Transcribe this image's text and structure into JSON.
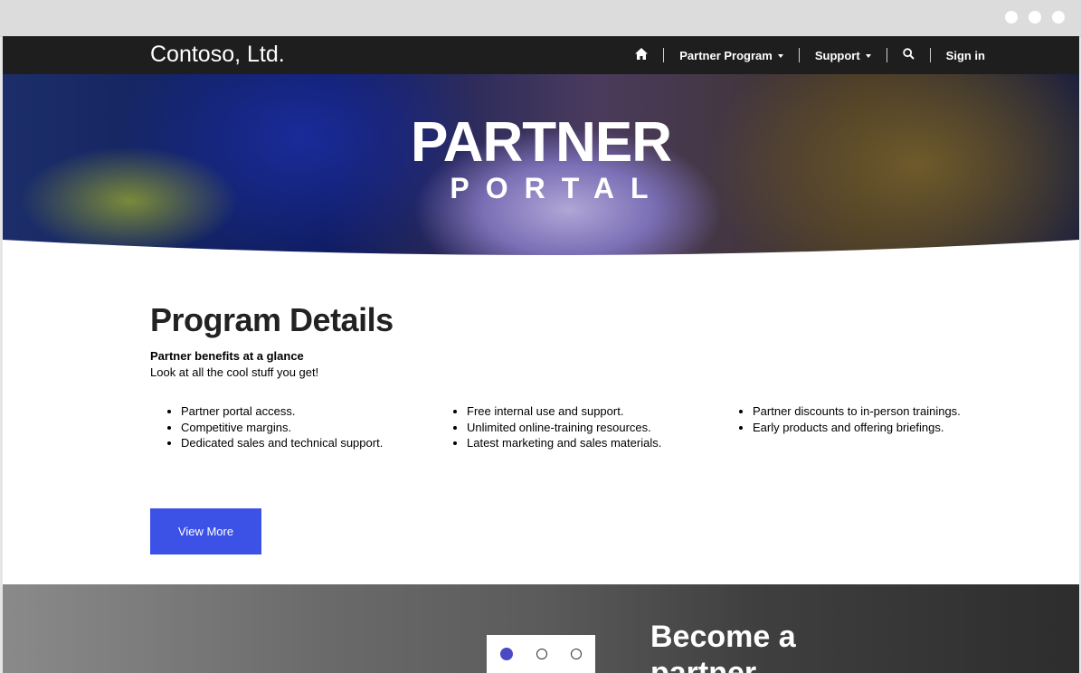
{
  "nav": {
    "brand": "Contoso, Ltd.",
    "items": [
      {
        "label": "Partner Program",
        "dropdown": true
      },
      {
        "label": "Support",
        "dropdown": true
      }
    ],
    "sign_in": "Sign in",
    "icons": [
      "home-icon",
      "search-icon"
    ]
  },
  "hero": {
    "title": "PARTNER",
    "subtitle": "PORTAL"
  },
  "details": {
    "title": "Program Details",
    "subtitle_strong": "Partner benefits at a glance",
    "subtitle": "Look at all the cool stuff you get!",
    "columns": [
      [
        "Partner portal access.",
        "Competitive margins.",
        "Dedicated sales and technical support."
      ],
      [
        "Free internal use and support.",
        "Unlimited online-training resources.",
        "Latest marketing and sales materials."
      ],
      [
        "Partner discounts to in-person trainings.",
        "Early products and offering briefings."
      ]
    ],
    "button": "View More"
  },
  "bottom": {
    "title_line1": "Become a",
    "title_line2": "partner"
  },
  "carousel": {
    "count": 3,
    "active": 0
  },
  "colors": {
    "nav_bg": "#1e1e1e",
    "accent": "#3c52e6",
    "carousel_active": "#4b49c4"
  }
}
